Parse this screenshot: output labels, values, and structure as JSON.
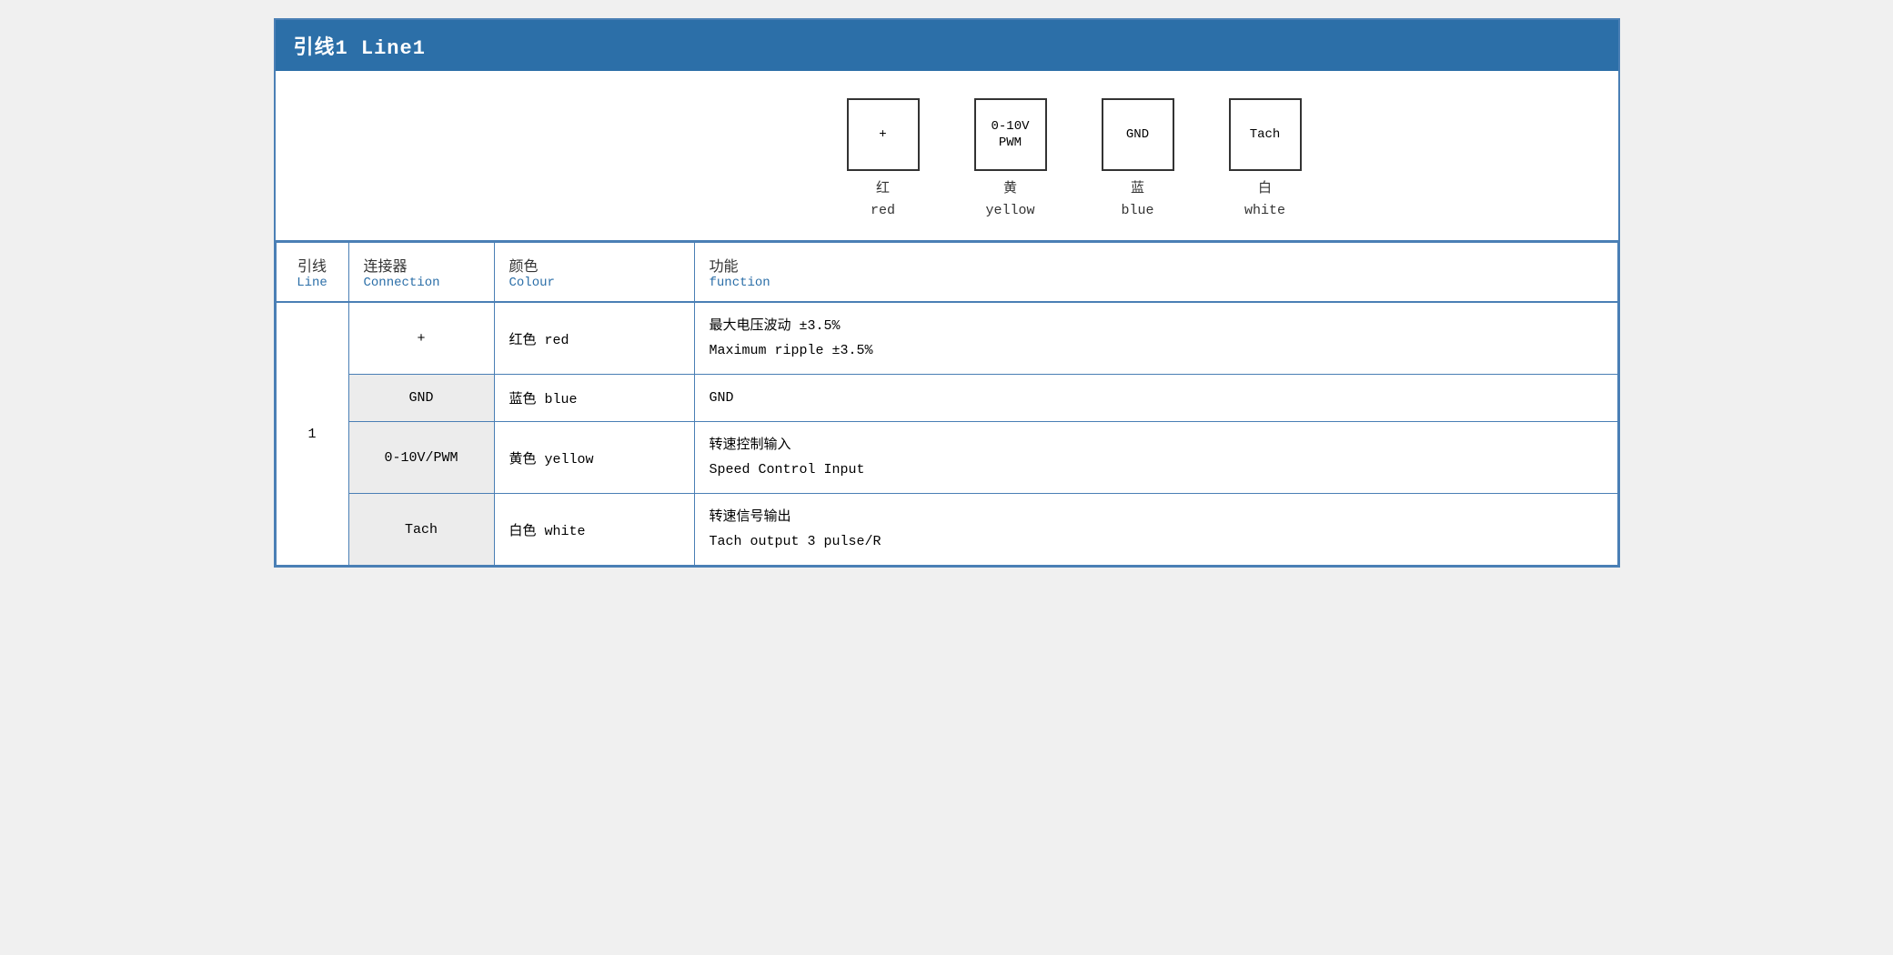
{
  "title": "引线1 Line1",
  "diagram": {
    "pins": [
      {
        "label": "+",
        "chinese": "红",
        "english": "red"
      },
      {
        "label": "0-10V\nPWM",
        "chinese": "黄",
        "english": "yellow"
      },
      {
        "label": "GND",
        "chinese": "蓝",
        "english": "blue"
      },
      {
        "label": "Tach",
        "chinese": "白",
        "english": "white"
      }
    ]
  },
  "table": {
    "headers": {
      "line_chinese": "引线",
      "line_english": "Line",
      "connection_chinese": "连接器",
      "connection_english": "Connection",
      "colour_chinese": "颜色",
      "colour_english": "Colour",
      "function_chinese": "功能",
      "function_english": "function"
    },
    "rows": [
      {
        "line": "1",
        "connection": "+",
        "colour": "红色 red",
        "function_chinese": "最大电压波动 ±3.5%",
        "function_english": "Maximum ripple ±3.5%"
      },
      {
        "line": "",
        "connection": "GND",
        "colour": "蓝色 blue",
        "function_chinese": "GND",
        "function_english": ""
      },
      {
        "line": "",
        "connection": "0-10V/PWM",
        "colour": "黄色 yellow",
        "function_chinese": "转速控制输入",
        "function_english": "Speed Control Input"
      },
      {
        "line": "",
        "connection": "Tach",
        "colour": "白色 white",
        "function_chinese": "转速信号输出",
        "function_english": "Tach output 3 pulse/R"
      }
    ]
  }
}
